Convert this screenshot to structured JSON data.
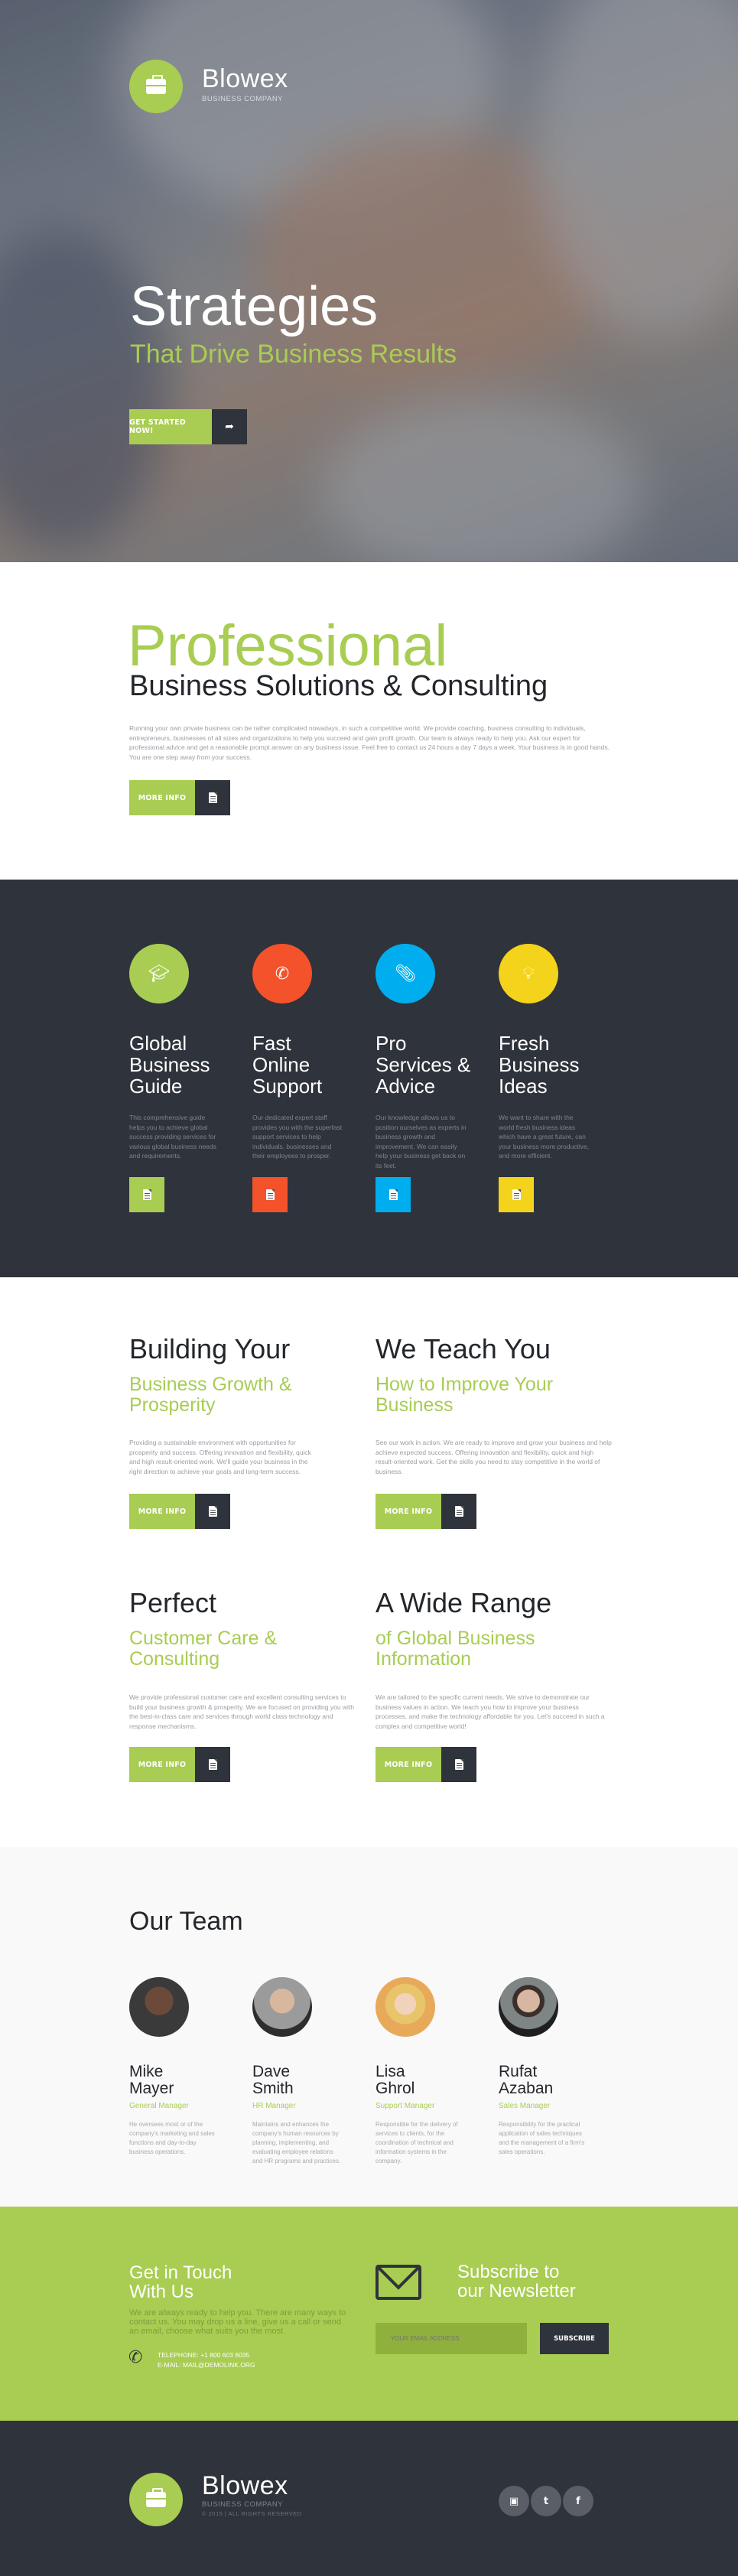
{
  "brand": {
    "name": "Blowex",
    "tagline": "BUSINESS COMPANY"
  },
  "hero": {
    "title": "Strategies",
    "subtitle": "That Drive Business Results",
    "cta_label": "GET STARTED NOW!"
  },
  "intro": {
    "title": "Professional",
    "subtitle": "Business Solutions & Consulting",
    "text": "Running your own private business can be rather complicated nowadays, in such a competitive world. We provide coaching, business consulting to individuals, entrepreneurs, businesses of all sizes and organizations to help you succeed and gain profit growth. Our team is always ready to help you. Ask our expert for professional advice and get a reasonable prompt answer on any business issue. Feel free to contact us 24 hours a day 7 days a week. Your business is in good hands. You are one step away from your success.",
    "button_label": "MORE INFO"
  },
  "features": [
    {
      "title": "Global Business Guide",
      "icon": "graduation-cap-icon",
      "color": "#a8cd52",
      "text": "This comprehensive guide helps you to achieve global success providing services for various global business needs and requirements."
    },
    {
      "title": "Fast Online Support",
      "icon": "phone-icon",
      "color": "#f4522a",
      "text": "Our dedicated expert staff provides you with the superfast support services to help individuals, businesses and their employees to prosper."
    },
    {
      "title": "Pro Services & Advice",
      "icon": "paperclip-icon",
      "color": "#00aeef",
      "text": "Our knowledge allows us to position ourselves as experts in business growth and improvement. We can easily help your business get back on its feet."
    },
    {
      "title": "Fresh Business Ideas",
      "icon": "lightbulb-icon",
      "color": "#f3d31c",
      "text": "We want to share with the world fresh business ideas which have a great future, can your business more productive, and more efficient."
    }
  ],
  "services": [
    {
      "title": "Building Your",
      "subtitle": "Business Growth & Prosperity",
      "text": "Providing a sustainable environment with opportunities for prosperity and success. Offering innovation and flexibility, quick and high result-oriented work. We'll guide your business in the right direction to achieve your goals and long-term success.",
      "button_label": "MORE INFO"
    },
    {
      "title": "We Teach You",
      "subtitle": "How to Improve Your Business",
      "text": "See our work in action. We are ready to improve and grow your business and help achieve expected success. Offering innovation and flexibility, quick and high result-oriented work. Get the skills you need to stay competitive in the world of business.",
      "button_label": "MORE INFO"
    },
    {
      "title": "Perfect",
      "subtitle": "Customer Care & Consulting",
      "text": "We provide professional customer care and excellent consulting services to build your business growth & prosperity. We are focused on providing you with the best-in-class care and services through world class technology and response mechanisms.",
      "button_label": "MORE INFO"
    },
    {
      "title": "A Wide Range",
      "subtitle": "of Global Business Information",
      "text": "We are tailored to the specific current needs. We strive to demonstrate our business values in action. We teach you how to improve your business processes, and make the technology affordable for you. Let's succeed in such a complex and competitive world!",
      "button_label": "MORE INFO"
    }
  ],
  "team": {
    "title": "Our Team",
    "members": [
      {
        "first": "Mike",
        "last": "Mayer",
        "role": "General Manager",
        "text": "He oversees most or of the company's marketing and sales functions and day-to-day business operations."
      },
      {
        "first": "Dave",
        "last": "Smith",
        "role": "HR Manager",
        "text": "Maintains and enhances the company's human resources by planning, implementing, and evaluating employee relations and HR programs and practices."
      },
      {
        "first": "Lisa",
        "last": "Ghrol",
        "role": "Support Manager",
        "text": "Responsible for the delivery of services to clients, for the coordination of technical and information systems in the company."
      },
      {
        "first": "Rufat",
        "last": "Azaban",
        "role": "Sales Manager",
        "text": "Responsibility for the practical application of sales techniques and the management of a firm's sales operations."
      }
    ]
  },
  "contact": {
    "title_line1": "Get in Touch",
    "title_line2": "With Us",
    "text": "We are always ready to help you. There are many ways to contact us. You may drop us a line, give us a call or send an email, choose what suits you the most.",
    "telephone": "TELEPHONE: +1 800 603 6035",
    "email": "E-MAIL: MAIL@DEMOLINK.ORG"
  },
  "newsletter": {
    "title_line1": "Subscribe to",
    "title_line2": "our Newsletter",
    "placeholder": "YOUR EMAIL ADDRESS",
    "button_label": "SUBSCRIBE"
  },
  "footer": {
    "name": "Blowex",
    "tagline": "BUSINESS COMPANY",
    "copyright": "© 2015 | ALL RIGHTS RESERVED",
    "social": [
      "instagram-icon",
      "twitter-icon",
      "facebook-icon"
    ]
  }
}
